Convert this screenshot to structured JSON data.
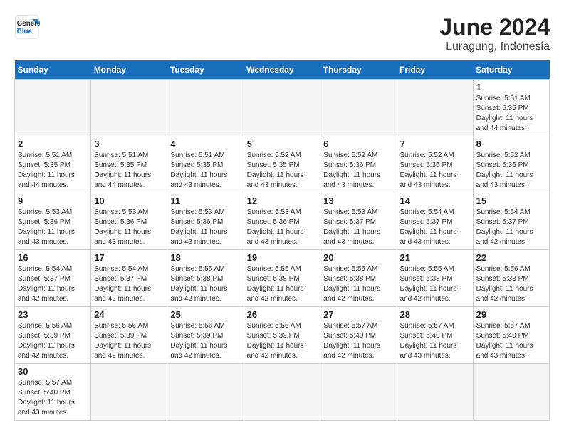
{
  "header": {
    "logo_general": "General",
    "logo_blue": "Blue",
    "title": "June 2024",
    "subtitle": "Luragung, Indonesia"
  },
  "weekdays": [
    "Sunday",
    "Monday",
    "Tuesday",
    "Wednesday",
    "Thursday",
    "Friday",
    "Saturday"
  ],
  "weeks": [
    [
      {
        "day": "",
        "sunrise": "",
        "sunset": "",
        "daylight": ""
      },
      {
        "day": "",
        "sunrise": "",
        "sunset": "",
        "daylight": ""
      },
      {
        "day": "",
        "sunrise": "",
        "sunset": "",
        "daylight": ""
      },
      {
        "day": "",
        "sunrise": "",
        "sunset": "",
        "daylight": ""
      },
      {
        "day": "",
        "sunrise": "",
        "sunset": "",
        "daylight": ""
      },
      {
        "day": "",
        "sunrise": "",
        "sunset": "",
        "daylight": ""
      },
      {
        "day": "1",
        "sunrise": "5:51 AM",
        "sunset": "5:35 PM",
        "daylight": "11 hours and 44 minutes."
      }
    ],
    [
      {
        "day": "2",
        "sunrise": "5:51 AM",
        "sunset": "5:35 PM",
        "daylight": "11 hours and 44 minutes."
      },
      {
        "day": "3",
        "sunrise": "5:51 AM",
        "sunset": "5:35 PM",
        "daylight": "11 hours and 44 minutes."
      },
      {
        "day": "4",
        "sunrise": "5:51 AM",
        "sunset": "5:35 PM",
        "daylight": "11 hours and 43 minutes."
      },
      {
        "day": "5",
        "sunrise": "5:52 AM",
        "sunset": "5:35 PM",
        "daylight": "11 hours and 43 minutes."
      },
      {
        "day": "6",
        "sunrise": "5:52 AM",
        "sunset": "5:36 PM",
        "daylight": "11 hours and 43 minutes."
      },
      {
        "day": "7",
        "sunrise": "5:52 AM",
        "sunset": "5:36 PM",
        "daylight": "11 hours and 43 minutes."
      },
      {
        "day": "8",
        "sunrise": "5:52 AM",
        "sunset": "5:36 PM",
        "daylight": "11 hours and 43 minutes."
      }
    ],
    [
      {
        "day": "9",
        "sunrise": "5:53 AM",
        "sunset": "5:36 PM",
        "daylight": "11 hours and 43 minutes."
      },
      {
        "day": "10",
        "sunrise": "5:53 AM",
        "sunset": "5:36 PM",
        "daylight": "11 hours and 43 minutes."
      },
      {
        "day": "11",
        "sunrise": "5:53 AM",
        "sunset": "5:36 PM",
        "daylight": "11 hours and 43 minutes."
      },
      {
        "day": "12",
        "sunrise": "5:53 AM",
        "sunset": "5:36 PM",
        "daylight": "11 hours and 43 minutes."
      },
      {
        "day": "13",
        "sunrise": "5:53 AM",
        "sunset": "5:37 PM",
        "daylight": "11 hours and 43 minutes."
      },
      {
        "day": "14",
        "sunrise": "5:54 AM",
        "sunset": "5:37 PM",
        "daylight": "11 hours and 43 minutes."
      },
      {
        "day": "15",
        "sunrise": "5:54 AM",
        "sunset": "5:37 PM",
        "daylight": "11 hours and 42 minutes."
      }
    ],
    [
      {
        "day": "16",
        "sunrise": "5:54 AM",
        "sunset": "5:37 PM",
        "daylight": "11 hours and 42 minutes."
      },
      {
        "day": "17",
        "sunrise": "5:54 AM",
        "sunset": "5:37 PM",
        "daylight": "11 hours and 42 minutes."
      },
      {
        "day": "18",
        "sunrise": "5:55 AM",
        "sunset": "5:38 PM",
        "daylight": "11 hours and 42 minutes."
      },
      {
        "day": "19",
        "sunrise": "5:55 AM",
        "sunset": "5:38 PM",
        "daylight": "11 hours and 42 minutes."
      },
      {
        "day": "20",
        "sunrise": "5:55 AM",
        "sunset": "5:38 PM",
        "daylight": "11 hours and 42 minutes."
      },
      {
        "day": "21",
        "sunrise": "5:55 AM",
        "sunset": "5:38 PM",
        "daylight": "11 hours and 42 minutes."
      },
      {
        "day": "22",
        "sunrise": "5:56 AM",
        "sunset": "5:38 PM",
        "daylight": "11 hours and 42 minutes."
      }
    ],
    [
      {
        "day": "23",
        "sunrise": "5:56 AM",
        "sunset": "5:39 PM",
        "daylight": "11 hours and 42 minutes."
      },
      {
        "day": "24",
        "sunrise": "5:56 AM",
        "sunset": "5:39 PM",
        "daylight": "11 hours and 42 minutes."
      },
      {
        "day": "25",
        "sunrise": "5:56 AM",
        "sunset": "5:39 PM",
        "daylight": "11 hours and 42 minutes."
      },
      {
        "day": "26",
        "sunrise": "5:56 AM",
        "sunset": "5:39 PM",
        "daylight": "11 hours and 42 minutes."
      },
      {
        "day": "27",
        "sunrise": "5:57 AM",
        "sunset": "5:40 PM",
        "daylight": "11 hours and 42 minutes."
      },
      {
        "day": "28",
        "sunrise": "5:57 AM",
        "sunset": "5:40 PM",
        "daylight": "11 hours and 43 minutes."
      },
      {
        "day": "29",
        "sunrise": "5:57 AM",
        "sunset": "5:40 PM",
        "daylight": "11 hours and 43 minutes."
      }
    ],
    [
      {
        "day": "30",
        "sunrise": "5:57 AM",
        "sunset": "5:40 PM",
        "daylight": "11 hours and 43 minutes."
      },
      {
        "day": "",
        "sunrise": "",
        "sunset": "",
        "daylight": ""
      },
      {
        "day": "",
        "sunrise": "",
        "sunset": "",
        "daylight": ""
      },
      {
        "day": "",
        "sunrise": "",
        "sunset": "",
        "daylight": ""
      },
      {
        "day": "",
        "sunrise": "",
        "sunset": "",
        "daylight": ""
      },
      {
        "day": "",
        "sunrise": "",
        "sunset": "",
        "daylight": ""
      },
      {
        "day": "",
        "sunrise": "",
        "sunset": "",
        "daylight": ""
      }
    ]
  ],
  "labels": {
    "sunrise": "Sunrise:",
    "sunset": "Sunset:",
    "daylight": "Daylight:"
  }
}
